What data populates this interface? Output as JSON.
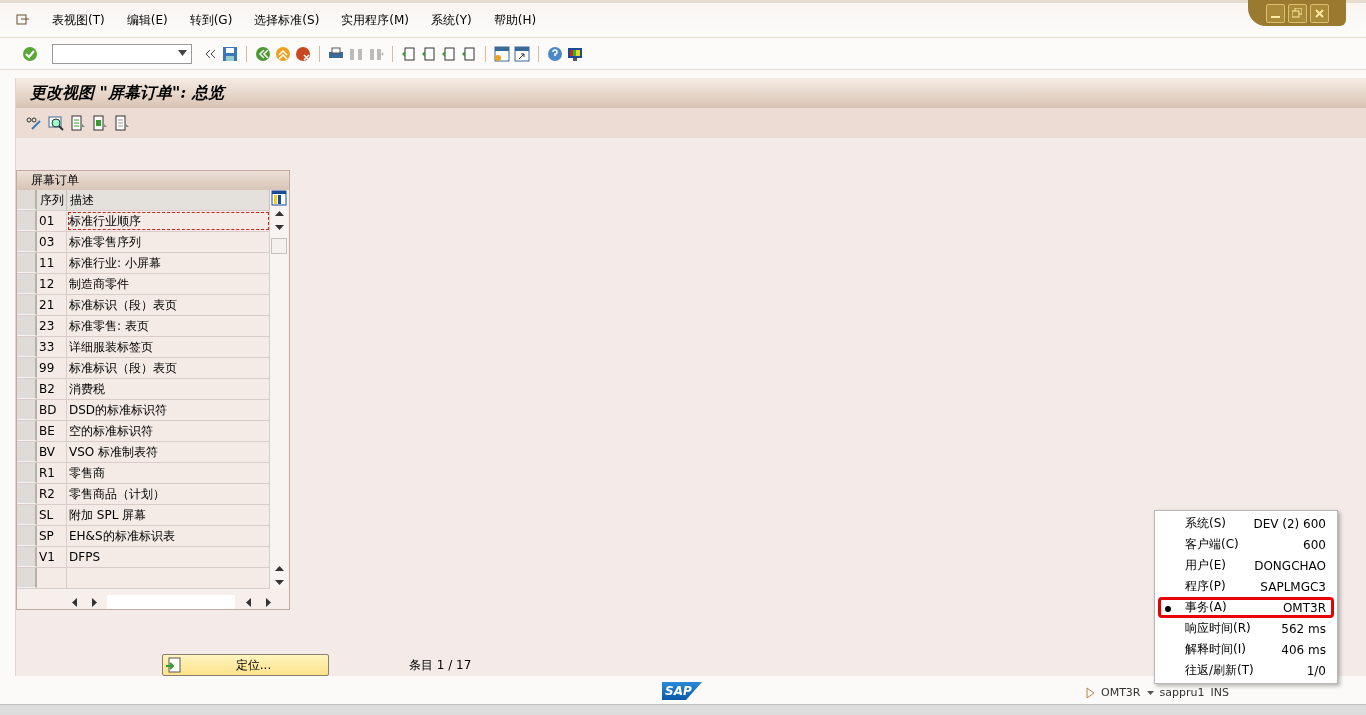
{
  "menu": [
    "表视图(T)",
    "编辑(E)",
    "转到(G)",
    "选择标准(S)",
    "实用程序(M)",
    "系统(Y)",
    "帮助(H)"
  ],
  "title": "更改视图 \"屏幕订单\": 总览",
  "table": {
    "title": "屏幕订单",
    "columns": [
      "序列",
      "描述"
    ],
    "rows": [
      {
        "cells": [
          "01",
          "标准行业顺序"
        ],
        "focused": true
      },
      {
        "cells": [
          "03",
          "标准零售序列"
        ],
        "focused": false
      },
      {
        "cells": [
          "11",
          "标准行业: 小屏幕"
        ],
        "focused": false
      },
      {
        "cells": [
          "12",
          "制造商零件"
        ],
        "focused": false
      },
      {
        "cells": [
          "21",
          "标准标识（段）表页"
        ],
        "focused": false
      },
      {
        "cells": [
          "23",
          "标准零售: 表页"
        ],
        "focused": false
      },
      {
        "cells": [
          "33",
          "详细服装标签页"
        ],
        "focused": false
      },
      {
        "cells": [
          "99",
          "标准标识（段）表页"
        ],
        "focused": false
      },
      {
        "cells": [
          "B2",
          "消费税"
        ],
        "focused": false
      },
      {
        "cells": [
          "BD",
          "DSD的标准标识符"
        ],
        "focused": false
      },
      {
        "cells": [
          "BE",
          "空的标准标识符"
        ],
        "focused": false
      },
      {
        "cells": [
          "BV",
          "VSO 标准制表符"
        ],
        "focused": false
      },
      {
        "cells": [
          "R1",
          "零售商"
        ],
        "focused": false
      },
      {
        "cells": [
          "R2",
          "零售商品（计划）"
        ],
        "focused": false
      },
      {
        "cells": [
          "SL",
          "附加 SPL 屏幕"
        ],
        "focused": false
      },
      {
        "cells": [
          "SP",
          "EH&S的标准标识表"
        ],
        "focused": false
      },
      {
        "cells": [
          "V1",
          "DFPS"
        ],
        "focused": false
      }
    ]
  },
  "position_button": "定位...",
  "entry_count": "条目 1 / 17",
  "logo": "SAP",
  "status_bar": {
    "transaction": "OMT3R",
    "server": "sappru1",
    "mode": "INS"
  },
  "system_popup": [
    {
      "label": "系统(S)",
      "value": "DEV (2) 600",
      "selected": false
    },
    {
      "label": "客户端(C)",
      "value": "600",
      "selected": false
    },
    {
      "label": "用户(E)",
      "value": "DONGCHAO",
      "selected": false
    },
    {
      "label": "程序(P)",
      "value": "SAPLMGC3",
      "selected": false
    },
    {
      "label": "事务(A)",
      "value": "OMT3R",
      "selected": true
    },
    {
      "label": "响应时间(R)",
      "value": "562 ms",
      "selected": false
    },
    {
      "label": "解释时间(I)",
      "value": "406 ms",
      "selected": false
    },
    {
      "label": "往返/刷新(T)",
      "value": "1/0",
      "selected": false
    }
  ]
}
